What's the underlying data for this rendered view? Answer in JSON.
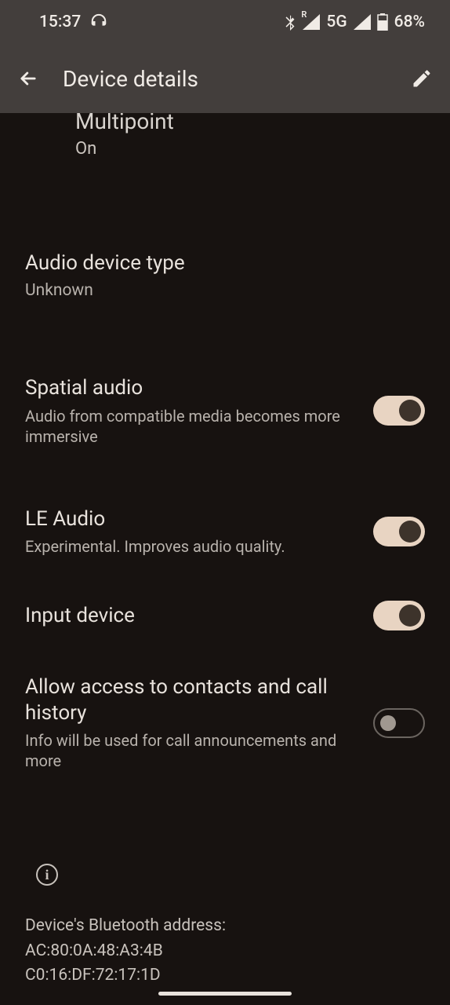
{
  "status": {
    "time": "15:37",
    "network": "5G",
    "battery": "68%"
  },
  "header": {
    "title": "Device details"
  },
  "partial": {
    "title": "Multipoint",
    "value": "On"
  },
  "sections": {
    "audioType": {
      "title": "Audio device type",
      "value": "Unknown"
    }
  },
  "settings": [
    {
      "title": "Spatial audio",
      "desc": "Audio from compatible media becomes more immersive",
      "on": true
    },
    {
      "title": "LE Audio",
      "desc": "Experimental. Improves audio quality.",
      "on": true
    },
    {
      "title": "Input device",
      "desc": "",
      "on": true
    },
    {
      "title": "Allow access to contacts and call history",
      "desc": "Info will be used for call announcements and more",
      "on": false
    }
  ],
  "footer": {
    "line1": "Device's Bluetooth address:",
    "line2": "AC:80:0A:48:A3:4B",
    "line3": "C0:16:DF:72:17:1D"
  }
}
